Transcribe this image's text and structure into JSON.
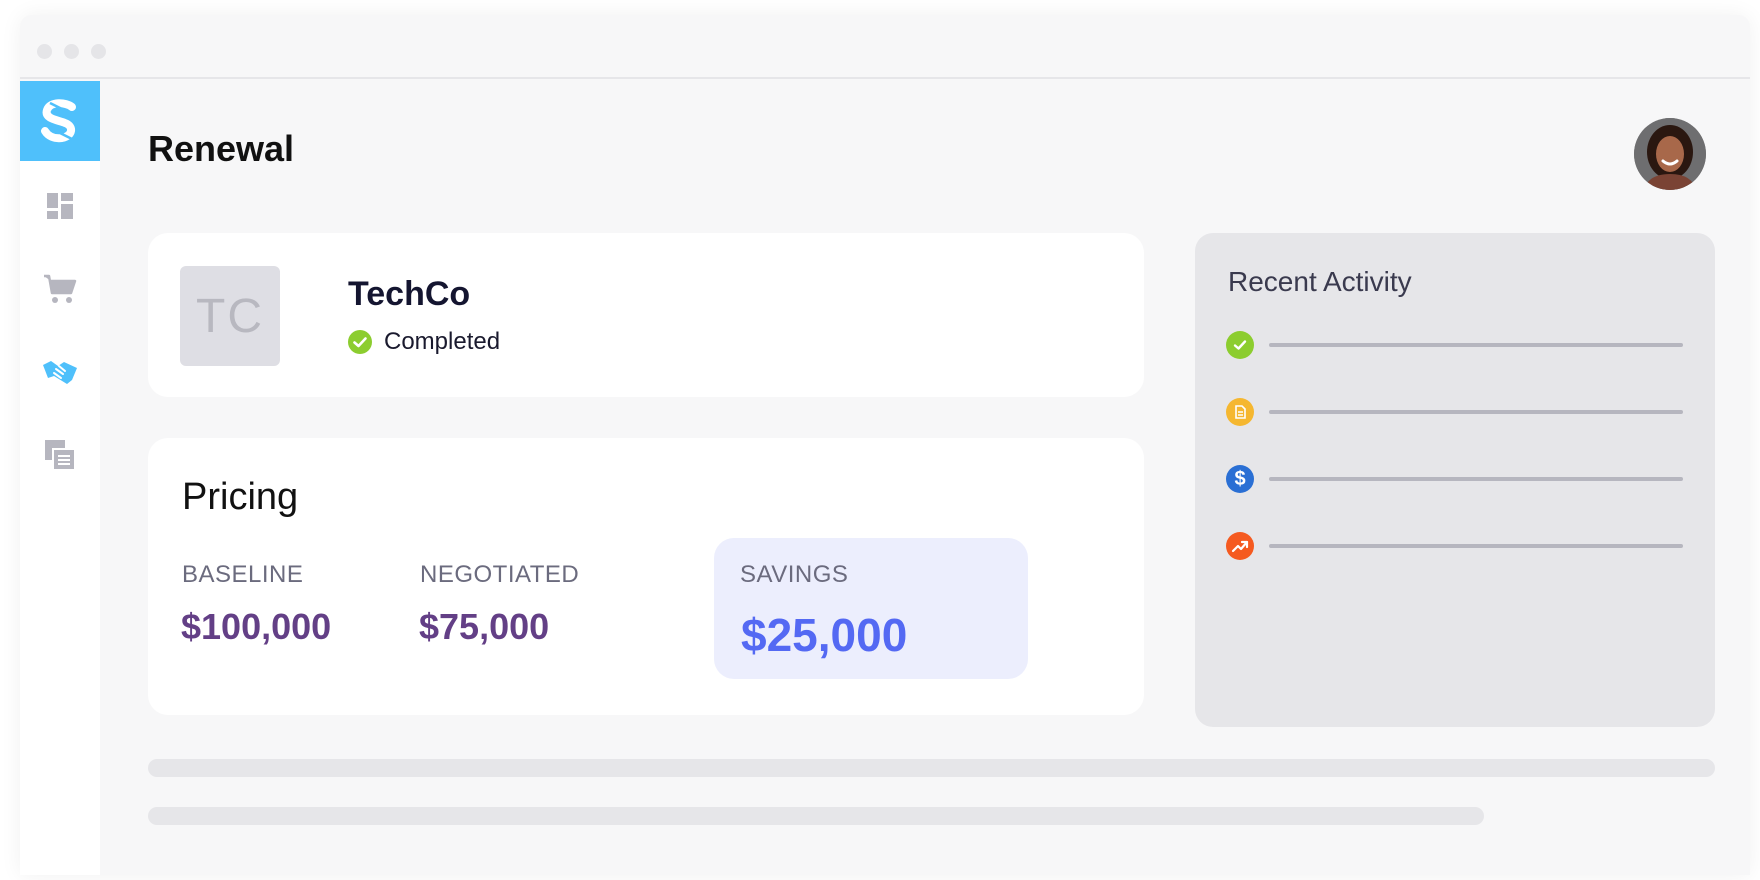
{
  "window": {
    "controls": [
      "close",
      "minimize",
      "maximize"
    ]
  },
  "sidebar": {
    "logo_icon": "brand-s-logo-icon",
    "items": [
      {
        "icon": "dashboard-icon",
        "active": false
      },
      {
        "icon": "cart-icon",
        "active": false
      },
      {
        "icon": "handshake-icon",
        "active": true
      },
      {
        "icon": "documents-icon",
        "active": false
      }
    ]
  },
  "header": {
    "title": "Renewal",
    "avatar_icon": "user-avatar"
  },
  "company": {
    "initials": "TC",
    "name": "TechCo",
    "status": "Completed",
    "status_color": "#8ccd2f"
  },
  "pricing": {
    "title": "Pricing",
    "baseline_label": "BASELINE",
    "baseline_value": "$100,000",
    "negotiated_label": "NEGOTIATED",
    "negotiated_value": "$75,000",
    "savings_label": "SAVINGS",
    "savings_value": "$25,000"
  },
  "activity": {
    "title": "Recent Activity",
    "items": [
      {
        "icon": "check-circle-icon",
        "color": "#8ccd2f"
      },
      {
        "icon": "document-icon",
        "color": "#f5b730"
      },
      {
        "icon": "dollar-icon",
        "color": "#2a6fd4"
      },
      {
        "icon": "trend-up-icon",
        "color": "#f55a20"
      }
    ]
  },
  "colors": {
    "brand": "#4fc0fb",
    "value_purple": "#633f86",
    "savings_blue": "#5469f3",
    "savings_bg": "#eceefd"
  }
}
